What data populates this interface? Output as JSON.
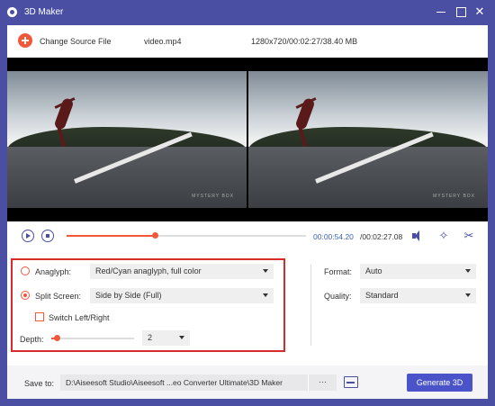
{
  "window": {
    "title": "3D Maker"
  },
  "topbar": {
    "change_source_label": "Change Source File",
    "file_name": "video.mp4",
    "file_info": "1280x720/00:02:27/38.40 MB"
  },
  "preview": {
    "watermark": "MYSTERY BOX"
  },
  "playback": {
    "current_time": "00:00:54.20",
    "total_time": "/00:02:27.08",
    "progress_fraction": 0.37
  },
  "settings": {
    "anaglyph": {
      "label": "Anaglyph:",
      "selected": false,
      "value": "Red/Cyan anaglyph, full color"
    },
    "split_screen": {
      "label": "Split Screen:",
      "selected": true,
      "value": "Side by Side (Full)"
    },
    "switch_left_right": {
      "label": "Switch Left/Right",
      "checked": false
    },
    "depth": {
      "label": "Depth:",
      "value": "2",
      "slider_fraction": 0.06
    },
    "format": {
      "label": "Format:",
      "value": "Auto"
    },
    "quality": {
      "label": "Quality:",
      "value": "Standard"
    }
  },
  "footer": {
    "save_to_label": "Save to:",
    "path": "D:\\Aiseesoft Studio\\Aiseesoft ...eo Converter Ultimate\\3D Maker",
    "more_label": "···",
    "generate_label": "Generate 3D"
  },
  "colors": {
    "accent": "#f1583a",
    "brand": "#4a4fa3",
    "highlight_box": "#d92b2b",
    "primary_button": "#4a54c8"
  }
}
